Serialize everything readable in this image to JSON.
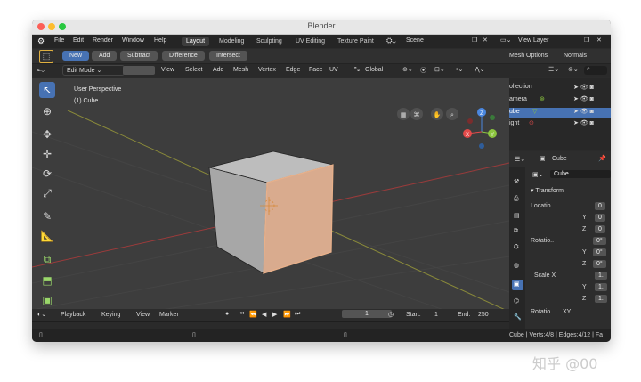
{
  "window": {
    "title": "Blender"
  },
  "menubar": {
    "items": [
      "File",
      "Edit",
      "Render",
      "Window",
      "Help"
    ],
    "workspaces": [
      "Layout",
      "Modeling",
      "Sculpting",
      "UV Editing",
      "Texture Paint"
    ],
    "active_workspace": "Layout",
    "scene": "Scene",
    "view_layer": "View Layer"
  },
  "tool_options": {
    "modes": [
      "New",
      "Add",
      "Subtract",
      "Difference",
      "Intersect"
    ],
    "active_mode": "New",
    "mesh_options": "Mesh Options",
    "normals": "Normals"
  },
  "viewport_header": {
    "mode": "Edit Mode",
    "menus": [
      "View",
      "Select",
      "Add",
      "Mesh",
      "Vertex",
      "Edge",
      "Face",
      "UV"
    ],
    "transform_orientation": "Global"
  },
  "viewport": {
    "perspective_label": "User Perspective",
    "object_label": "(1) Cube",
    "gizmo_axes": [
      "Z",
      "X",
      "Y"
    ]
  },
  "outliner": {
    "header": "ollection",
    "rows": [
      "amera",
      "ube",
      "ight"
    ]
  },
  "properties": {
    "object_name": "Cube",
    "mesh_name": "Cube",
    "section": "Transform",
    "location": {
      "label": "Locatio..",
      "values": [
        "0",
        "0",
        "0"
      ]
    },
    "rotation": {
      "label": "Rotatio..",
      "values": [
        "0°",
        "0°",
        "0°"
      ]
    },
    "scale": {
      "label": "Scale X",
      "values": [
        "1.",
        "1.",
        "1."
      ]
    },
    "rotation_mode": {
      "label": "Rotatio..",
      "value": "XY"
    },
    "axes": [
      "X",
      "Y",
      "Z"
    ]
  },
  "timeline": {
    "menus": [
      "Playback",
      "Keying",
      "View",
      "Marker"
    ],
    "current_frame": "1",
    "start_label": "Start:",
    "start": "1",
    "end_label": "End:",
    "end": "250"
  },
  "status": "Cube | Verts:4/8 | Edges:4/12 | Fa",
  "watermark": "知乎 @00",
  "colors": {
    "accent": "#4772b3",
    "axis_x": "#e34a4a",
    "axis_y": "#8cc63f",
    "axis_z": "#4a87e0"
  }
}
